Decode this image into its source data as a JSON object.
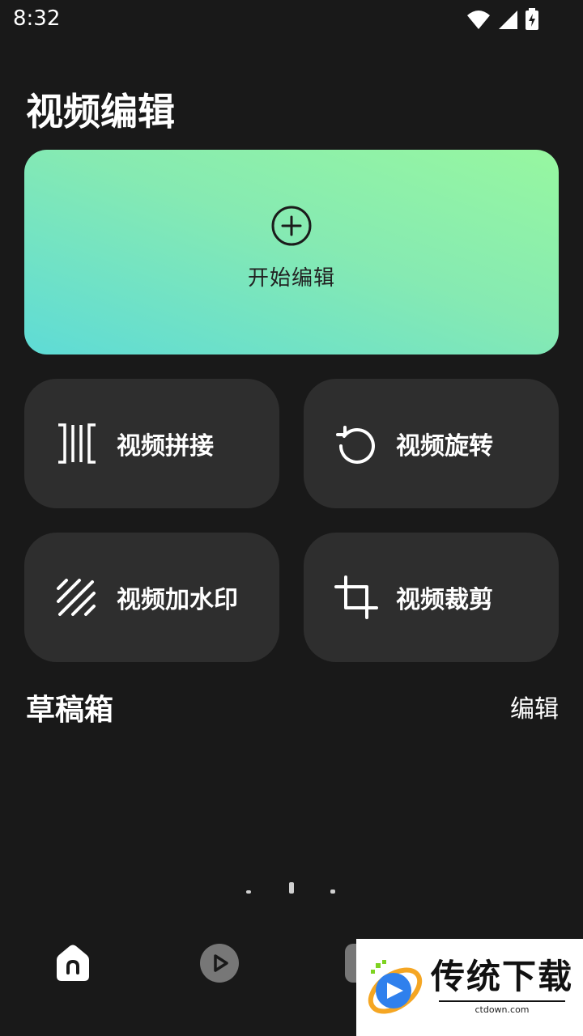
{
  "status_bar": {
    "time": "8:32",
    "icons": [
      "wifi-icon",
      "signal-icon",
      "battery-charging-icon"
    ]
  },
  "page": {
    "title": "视频编辑"
  },
  "hero": {
    "label": "开始编辑",
    "icon": "plus-circle-icon",
    "gradient": [
      "#97f7a0",
      "#86eab2",
      "#5edbd6"
    ]
  },
  "tools": [
    {
      "label": "视频拼接",
      "icon": "merge-icon"
    },
    {
      "label": "视频旋转",
      "icon": "rotate-icon"
    },
    {
      "label": "视频加水印",
      "icon": "watermark-icon"
    },
    {
      "label": "视频裁剪",
      "icon": "crop-icon"
    }
  ],
  "drafts": {
    "title": "草稿箱",
    "action": "编辑"
  },
  "bottom_nav": {
    "items": [
      "home-icon",
      "play-icon",
      "more-icon"
    ],
    "active": "home-icon"
  },
  "watermark": {
    "title": "传统下载",
    "subtitle": "ctdown.com"
  },
  "colors": {
    "background": "#191919",
    "card": "#2e2e2e",
    "text": "#ffffff"
  }
}
